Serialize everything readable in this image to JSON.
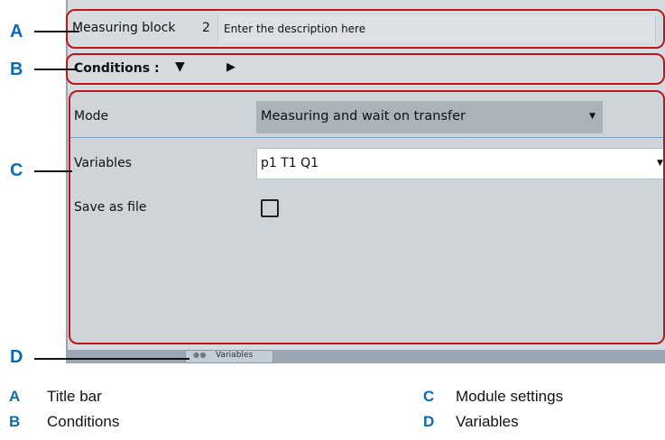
{
  "title_bar": {
    "block_name": "Measuring block",
    "block_number": "2",
    "description": "Enter the description here"
  },
  "conditions": {
    "label": "Conditions :",
    "expand_icon": "triangle-down-icon",
    "next_icon": "triangle-right-icon"
  },
  "settings": {
    "mode": {
      "label": "Mode",
      "value": "Measuring and wait on transfer"
    },
    "variables": {
      "label": "Variables",
      "value": "p1 T1 Q1"
    },
    "save_as_file": {
      "label": "Save as file",
      "checked": false
    }
  },
  "bottom_tab": {
    "label": "Variables",
    "icon": "dots-icon"
  },
  "callouts": [
    "A",
    "B",
    "C",
    "D"
  ],
  "legend": [
    {
      "letter": "A",
      "text": "Title bar"
    },
    {
      "letter": "B",
      "text": "Conditions"
    },
    {
      "letter": "C",
      "text": "Module settings"
    },
    {
      "letter": "D",
      "text": "Variables"
    }
  ],
  "colors": {
    "callout_red": "#c0141d",
    "marker_blue": "#0b6ab2",
    "panel_gray": "#d6dbe0"
  }
}
